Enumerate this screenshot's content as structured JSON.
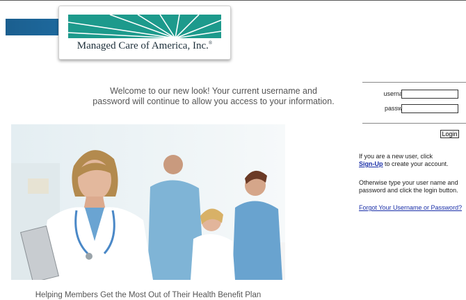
{
  "brand": {
    "name": "Managed Care of America, Inc.",
    "registered_mark": "®",
    "colors": {
      "teal": "#1d9a8c",
      "blue_bar": "#1f6fa6"
    }
  },
  "welcome": {
    "line1": "Welcome to our new look! Your current username and",
    "line2": "password will continue to allow you access to your information."
  },
  "login": {
    "username_label": "username:",
    "username_value": "",
    "password_label": "password:",
    "password_value": "",
    "button_label": "Login"
  },
  "info": {
    "new_user_line1": "If you are a new user, click",
    "signup_link": "Sign-Up",
    "new_user_line2": " to create your account.",
    "otherwise_text": "Otherwise type your user name and password and click the login button.",
    "forgot_link": "Forgot Your Username or Password?"
  },
  "hero": {
    "caption": "Helping Members Get the Most Out of Their Health Benefit Plan"
  }
}
